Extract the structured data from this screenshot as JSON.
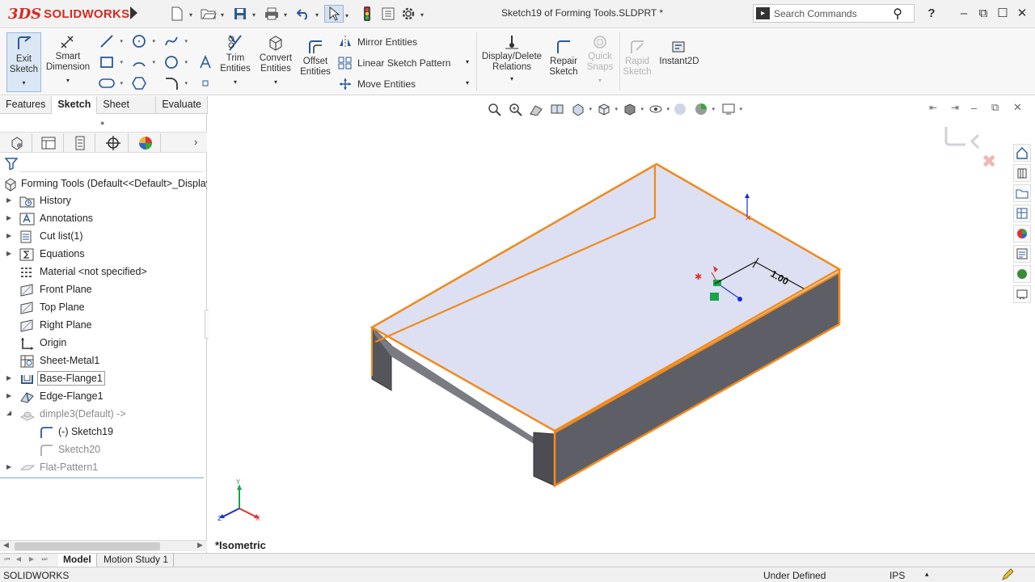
{
  "app": {
    "brand_prefix": "3DS",
    "brand": "SOLIDWORKS",
    "document_title": "Sketch19 of Forming Tools.SLDPRT *"
  },
  "search": {
    "placeholder": "Search Commands"
  },
  "ribbon": {
    "exit_sketch": "Exit\nSketch",
    "smart_dimension": "Smart\nDimension",
    "trim_entities": "Trim\nEntities",
    "convert_entities": "Convert\nEntities",
    "offset_entities": "Offset\nEntities",
    "mirror_entities": "Mirror Entities",
    "linear_sketch_pattern": "Linear Sketch Pattern",
    "move_entities": "Move Entities",
    "display_delete_relations": "Display/Delete\nRelations",
    "repair_sketch": "Repair\nSketch",
    "quick_snaps": "Quick\nSnaps",
    "rapid_sketch": "Rapid\nSketch",
    "instant2d": "Instant2D"
  },
  "command_tabs": [
    "Features",
    "Sketch",
    "Sheet Metal",
    "Evaluate"
  ],
  "tree": {
    "root": "Forming Tools  (Default<<Default>_Display",
    "items": [
      {
        "label": "History",
        "icon": "history-folder-icon"
      },
      {
        "label": "Annotations",
        "icon": "annotations-icon"
      },
      {
        "label": "Cut list(1)",
        "icon": "cut-list-icon"
      },
      {
        "label": "Equations",
        "icon": "equations-icon"
      },
      {
        "label": "Material <not specified>",
        "icon": "material-icon"
      },
      {
        "label": "Front Plane",
        "icon": "plane-icon"
      },
      {
        "label": "Top Plane",
        "icon": "plane-icon"
      },
      {
        "label": "Right Plane",
        "icon": "plane-icon"
      },
      {
        "label": "Origin",
        "icon": "origin-icon"
      },
      {
        "label": "Sheet-Metal1",
        "icon": "sheet-metal-icon"
      },
      {
        "label": "Base-Flange1",
        "icon": "base-flange-icon"
      },
      {
        "label": "Edge-Flange1",
        "icon": "edge-flange-icon"
      },
      {
        "label": "dimple3(Default) ->",
        "icon": "form-tool-icon"
      },
      {
        "label": "(-) Sketch19",
        "icon": "sketch-icon"
      },
      {
        "label": "Sketch20",
        "icon": "sketch-icon"
      },
      {
        "label": "Flat-Pattern1",
        "icon": "flat-pattern-icon"
      }
    ]
  },
  "viewport": {
    "view_name": "*Isometric",
    "dimension_value": "1.00"
  },
  "bottom_tabs": [
    "Model",
    "Motion Study 1"
  ],
  "status": {
    "app": "SOLIDWORKS",
    "state": "Under Defined",
    "units": "IPS"
  },
  "colors": {
    "accent_orange": "#f08a1c",
    "face_fill": "#dde0f2",
    "side_fill": "#6b6b73",
    "brand_red": "#d52b1e"
  }
}
